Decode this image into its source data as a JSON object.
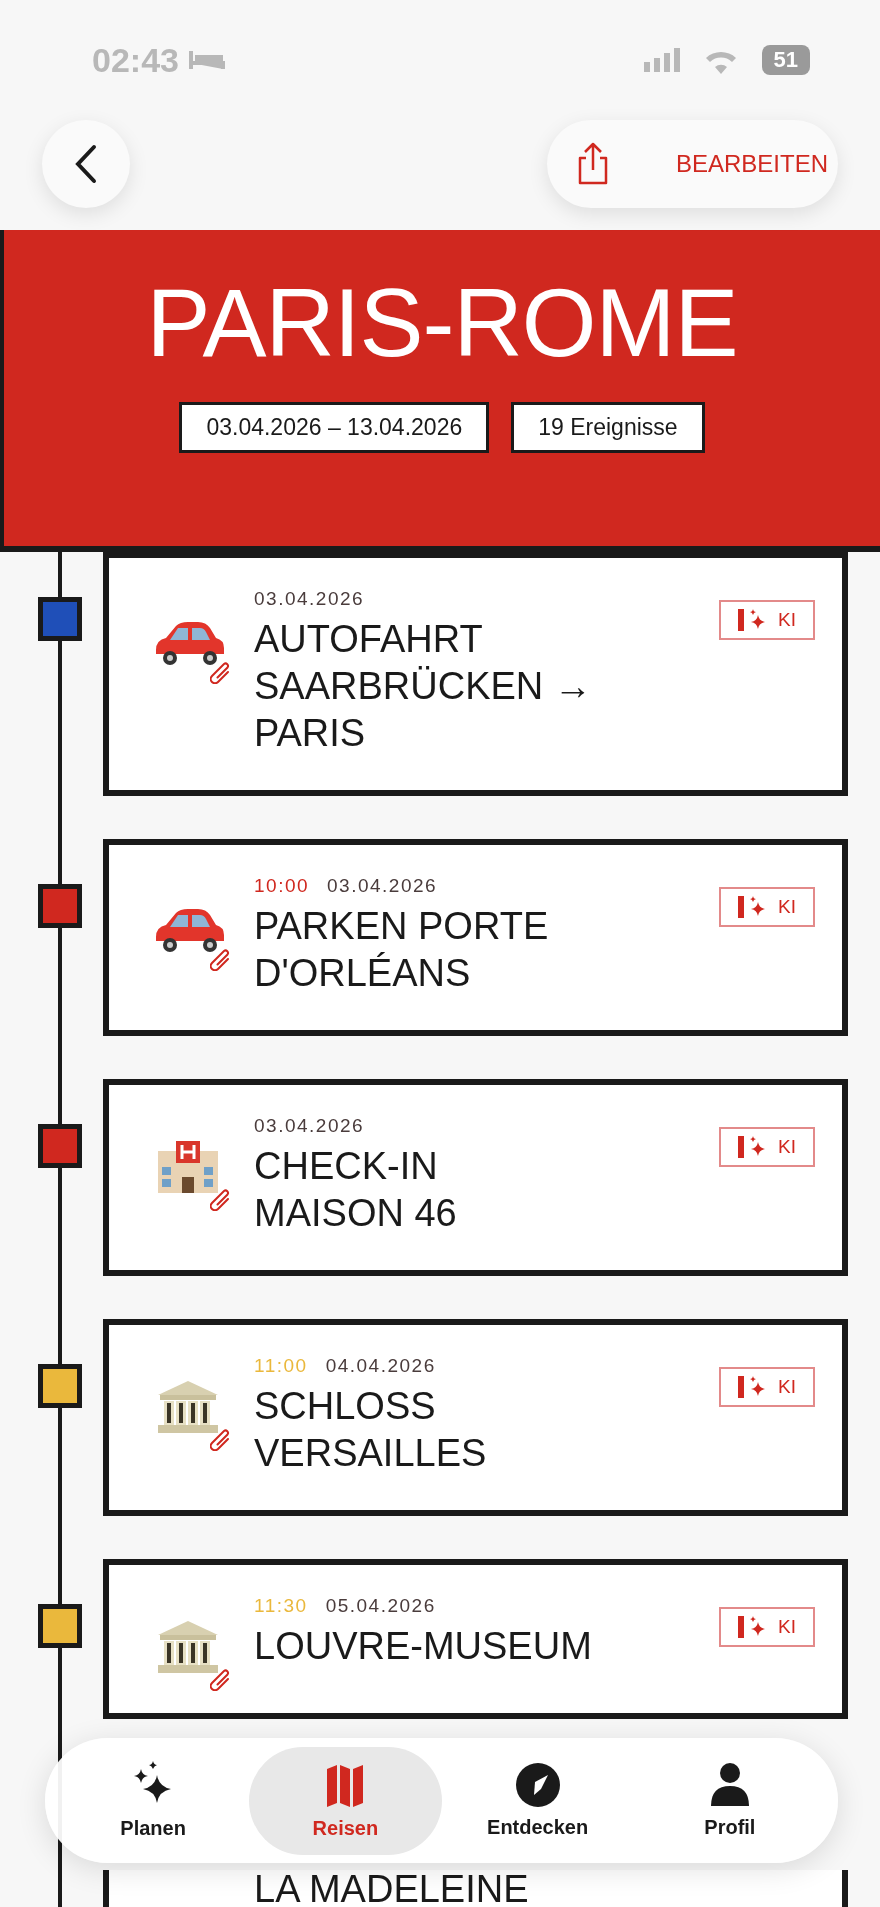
{
  "status_bar": {
    "time": "02:43",
    "battery": "51"
  },
  "toolbar": {
    "edit_label": "BEARBEITEN"
  },
  "trip": {
    "title": "PARIS-ROME",
    "date_range": "03.04.2026 – 13.04.2026",
    "event_count": "19 Ereignisse"
  },
  "events": [
    {
      "kind": "car",
      "color": "#1f4fb8",
      "date": "03.04.2026",
      "title": "AUTOFAHRT\nSAARBRÜCKEN →\nPARIS",
      "badge": "KI"
    },
    {
      "kind": "car",
      "color": "#d0281f",
      "time": "10:00",
      "date": "03.04.2026",
      "title": "PARKEN PORTE\nD'ORLÉANS",
      "badge": "KI"
    },
    {
      "kind": "hotel",
      "color": "#d0281f",
      "date": "03.04.2026",
      "title": "CHECK-IN\nMAISON 46",
      "badge": "KI"
    },
    {
      "kind": "museum",
      "color": "#eab83c",
      "time": "11:00",
      "date": "04.04.2026",
      "title": "SCHLOSS\nVERSAILLES",
      "badge": "KI"
    },
    {
      "kind": "museum",
      "color": "#eab83c",
      "time": "11:30",
      "date": "05.04.2026",
      "title": "LOUVRE-MUSEUM",
      "badge": "KI"
    },
    {
      "title": "LA MADELEINE"
    }
  ],
  "tab_bar": [
    {
      "kind": "sparkle",
      "label": "Planen",
      "selected": false
    },
    {
      "kind": "map",
      "label": "Reisen",
      "selected": true
    },
    {
      "kind": "compass",
      "label": "Entdecken",
      "selected": false
    },
    {
      "kind": "person",
      "label": "Profil",
      "selected": false
    }
  ]
}
